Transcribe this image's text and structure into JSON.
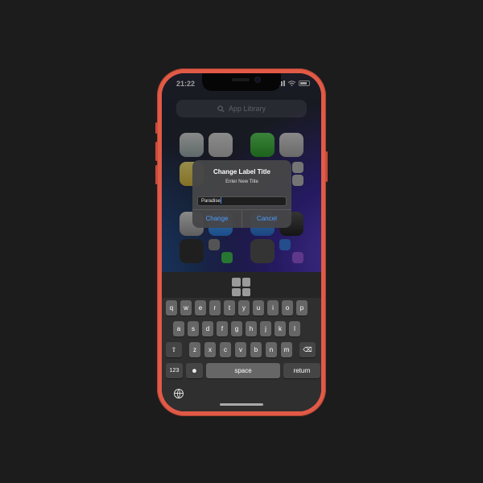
{
  "status": {
    "time": "21:22"
  },
  "search": {
    "placeholder": "App Library"
  },
  "alert": {
    "title": "Change Label Title",
    "message": "Enter New Title",
    "input_value": "Paradise",
    "confirm_label": "Change",
    "cancel_label": "Cancel"
  },
  "keyboard": {
    "row1": [
      "q",
      "w",
      "e",
      "r",
      "t",
      "y",
      "u",
      "i",
      "o",
      "p"
    ],
    "row2": [
      "a",
      "s",
      "d",
      "f",
      "g",
      "h",
      "j",
      "k",
      "l"
    ],
    "row3": [
      "z",
      "x",
      "c",
      "v",
      "b",
      "n",
      "m"
    ],
    "numbers_label": "123",
    "space_label": "space",
    "return_label": "return",
    "shift_glyph": "⇧",
    "delete_glyph": "⌫",
    "emoji_glyph": "☻"
  },
  "colors": {
    "accent": "#4d9cff",
    "frame": "#e15a46"
  }
}
